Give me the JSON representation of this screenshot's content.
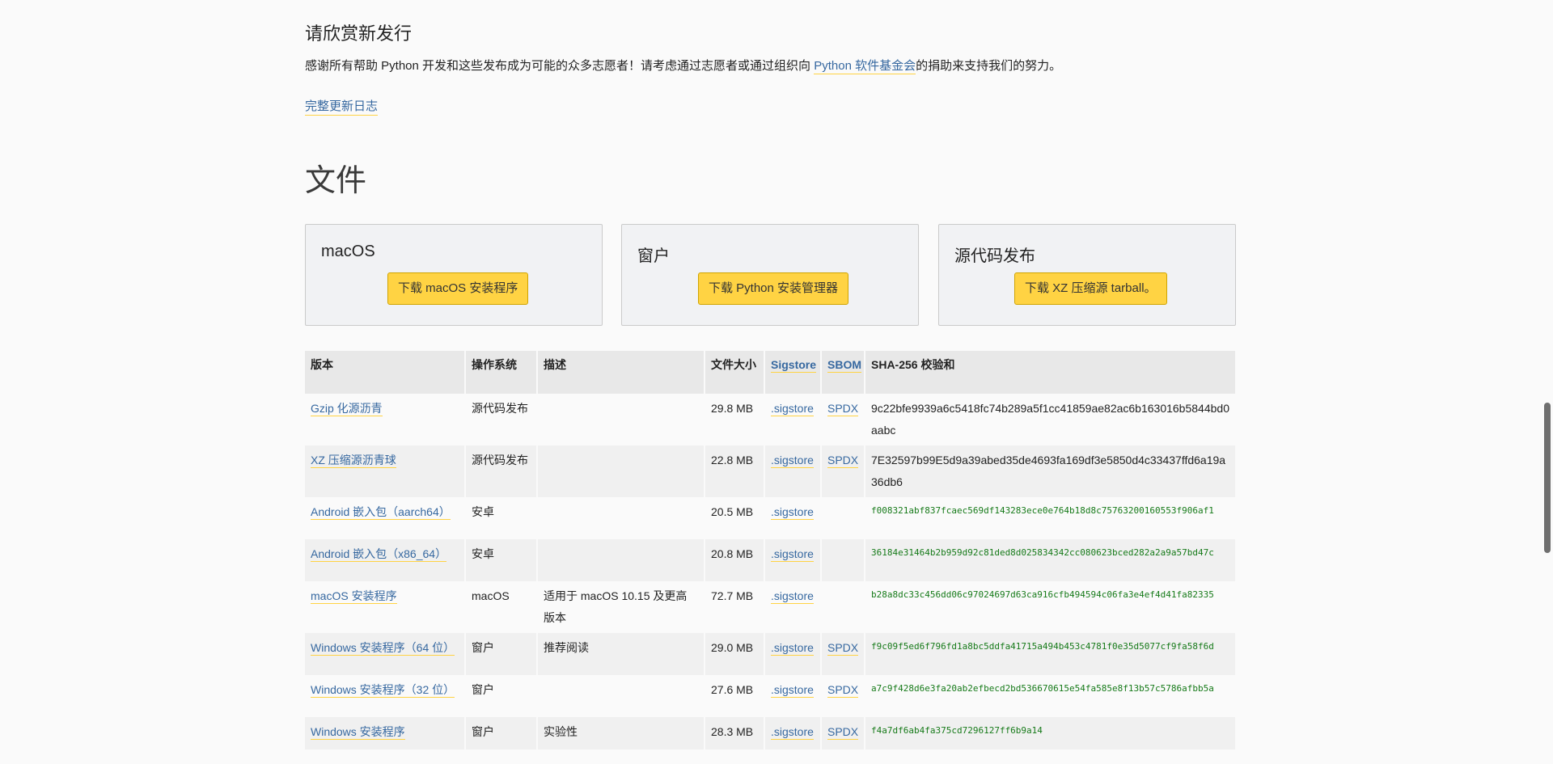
{
  "release": {
    "heading": "请欣赏新发行",
    "thanks_prefix": "感谢所有帮助 Python 开发和这些发布成为可能的众多志愿者！请考虑通过志愿者或通过组织向 ",
    "thanks_link": "Python 软件基金会",
    "thanks_suffix": "的捐助来支持我们的努力。",
    "changelog": "完整更新日志"
  },
  "files": {
    "heading": "文件",
    "cards": [
      {
        "title": "macOS",
        "button": "下载 macOS 安装程序"
      },
      {
        "title": "窗户",
        "button": "下载 Python 安装管理器"
      },
      {
        "title": "源代码发布",
        "button": "下载 XZ 压缩源 tarball。"
      }
    ],
    "table": {
      "headers": {
        "version": "版本",
        "os": "操作系统",
        "description": "描述",
        "size": "文件大小",
        "sigstore": "Sigstore",
        "sbom": "SBOM",
        "sha": "SHA-256 校验和"
      },
      "rows": [
        {
          "version": "Gzip 化源沥青",
          "os": "源代码发布",
          "description": "",
          "size": "29.8 MB",
          "sigstore": ".sigstore",
          "sbom": "SPDX",
          "sha": "9c22bfe9939a6c5418fc74b289a5f1cc41859ae82ac6b163016b5844bd0aabc"
        },
        {
          "version": "XZ 压缩源沥青球",
          "os": "源代码发布",
          "description": "",
          "size": "22.8 MB",
          "sigstore": ".sigstore",
          "sbom": "SPDX",
          "sha": "7E32597b99E5d9a39abed35de4693fa169df3e5850d4c33437ffd6a19a36db6"
        },
        {
          "version": "Android 嵌入包（aarch64）",
          "os": "安卓",
          "description": "",
          "size": "20.5 MB",
          "sigstore": ".sigstore",
          "sbom": "",
          "sha": "f008321abf837fcaec569df143283ece0e764b18d8c75763200160553f906af1"
        },
        {
          "version": "Android 嵌入包（x86_64）",
          "os": "安卓",
          "description": "",
          "size": "20.8 MB",
          "sigstore": ".sigstore",
          "sbom": "",
          "sha": "36184e31464b2b959d92c81ded8d025834342cc080623bced282a2a9a57bd47c"
        },
        {
          "version": "macOS 安装程序",
          "os": "macOS",
          "description": "适用于 macOS 10.15 及更高版本",
          "size": "72.7 MB",
          "sigstore": ".sigstore",
          "sbom": "",
          "sha": "b28a8dc33c456dd06c97024697d63ca916cfb494594c06fa3e4ef4d41fa82335"
        },
        {
          "version": "Windows 安装程序（64 位）",
          "os": "窗户",
          "description": "推荐阅读",
          "size": "29.0 MB",
          "sigstore": ".sigstore",
          "sbom": "SPDX",
          "sha": "f9c09f5ed6f796fd1a8bc5ddfa41715a494b453c4781f0e35d5077cf9fa58f6d"
        },
        {
          "version": "Windows 安装程序（32 位）",
          "os": "窗户",
          "description": "",
          "size": "27.6 MB",
          "sigstore": ".sigstore",
          "sbom": "SPDX",
          "sha": "a7c9f428d6e3fa20ab2efbecd2bd536670615e54fa585e8f13b57c5786afbb5a"
        },
        {
          "version": "Windows 安装程序",
          "os": "窗户",
          "description": "实验性",
          "size": "28.3 MB",
          "sigstore": ".sigstore",
          "sbom": "SPDX",
          "sha": "f4a7df6ab4fa375cd7296127ff6b9a14"
        }
      ]
    }
  }
}
